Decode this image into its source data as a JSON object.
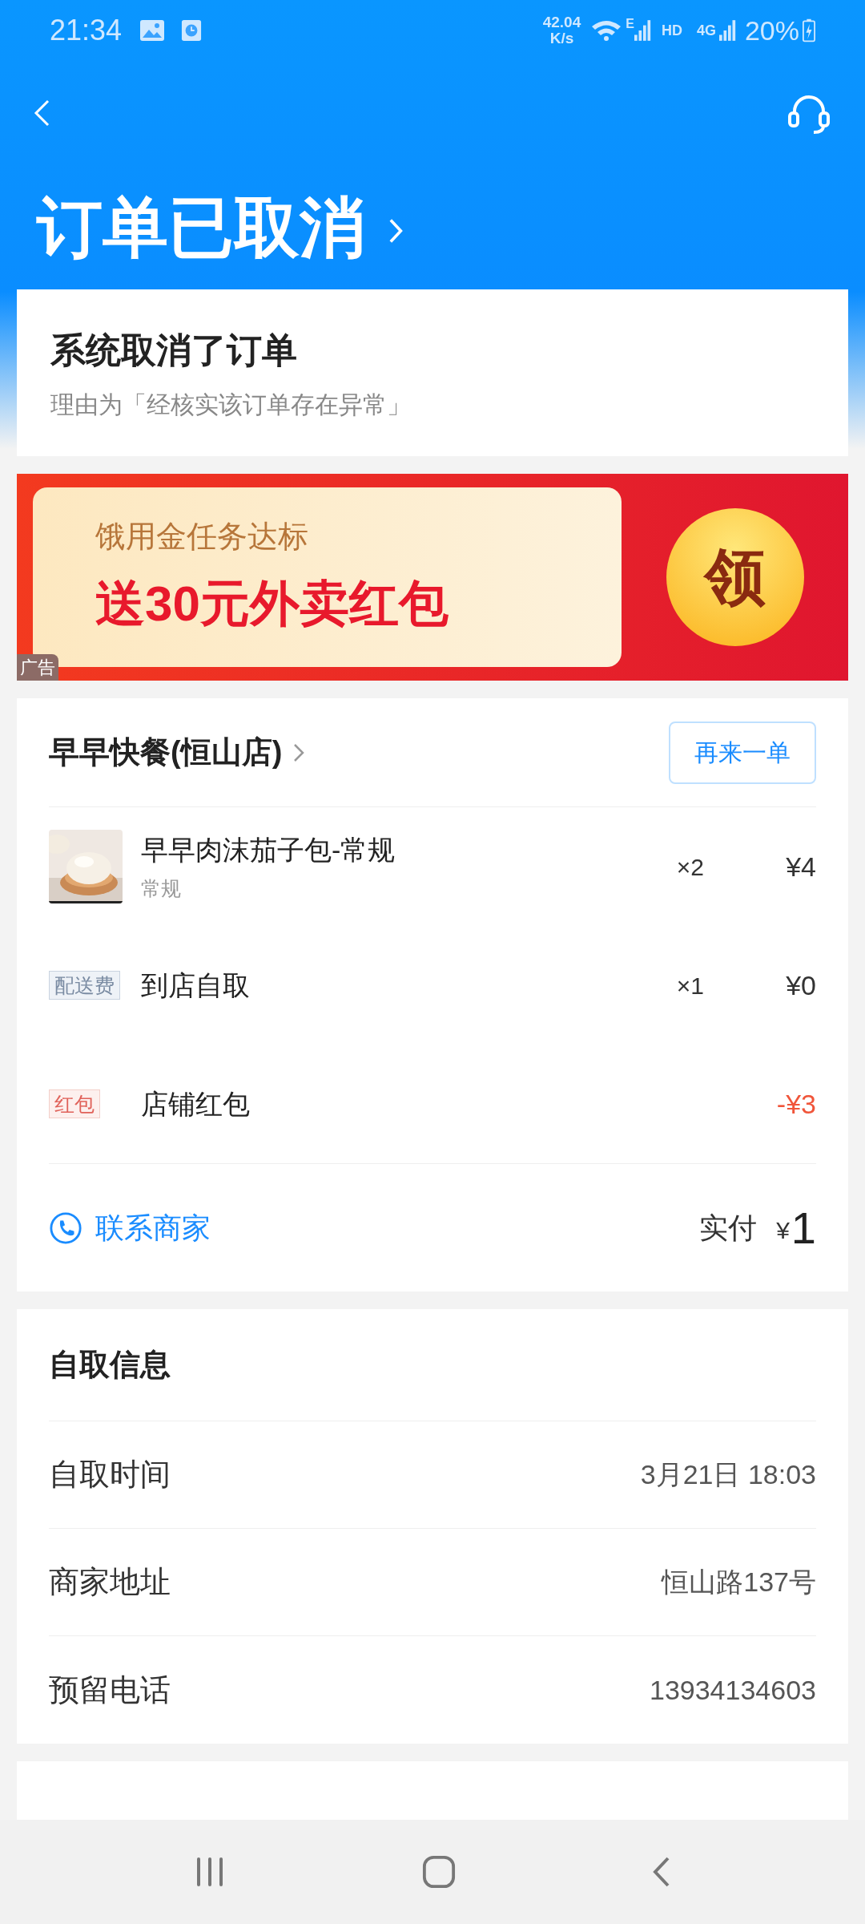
{
  "status_bar": {
    "time": "21:34",
    "speed_value": "42.04",
    "speed_unit": "K/s",
    "net_type_1": "E",
    "hd": "HD",
    "net_type_2": "4G",
    "battery": "20%",
    "charging": true
  },
  "header": {
    "title": "订单已取消"
  },
  "cancel_card": {
    "title": "系统取消了订单",
    "reason": "理由为「经核实该订单存在异常」"
  },
  "banner": {
    "line_1": "饿用金任务达标",
    "line_2": "送30元外卖红包",
    "claim": "领",
    "ad_tag": "广告"
  },
  "store": {
    "name": "早早快餐(恒山店)",
    "reorder": "再来一单",
    "items": [
      {
        "kind": "product",
        "name": "早早肉沫茄子包-常规",
        "spec": "常规",
        "qty": "×2",
        "price": "¥4"
      },
      {
        "kind": "fee",
        "tag": "配送费",
        "name": "到店自取",
        "qty": "×1",
        "price": "¥0"
      },
      {
        "kind": "discount",
        "tag": "红包",
        "name": "店铺红包",
        "price": "-¥3"
      }
    ],
    "contact": "联系商家",
    "paid_label": "实付",
    "currency": "¥",
    "paid_amount": "1"
  },
  "pickup": {
    "title": "自取信息",
    "rows": [
      {
        "label": "自取时间",
        "value": "3月21日 18:03"
      },
      {
        "label": "商家地址",
        "value": "恒山路137号"
      },
      {
        "label": "预留电话",
        "value": "13934134603"
      }
    ]
  }
}
